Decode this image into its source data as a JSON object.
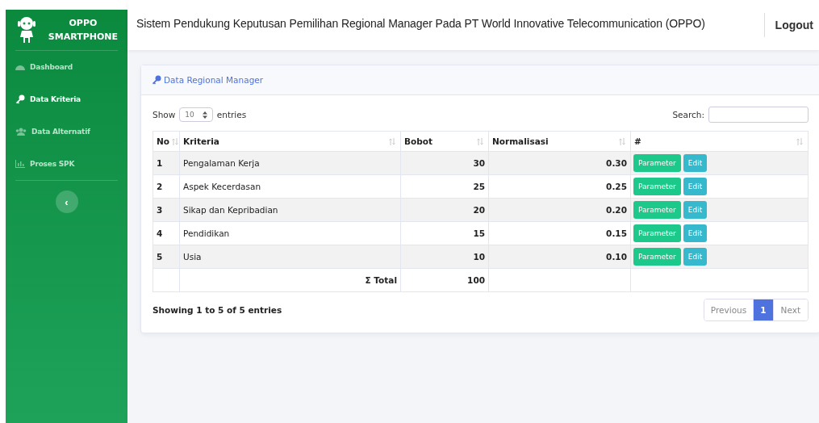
{
  "sidebar": {
    "brand": [
      "OPPO",
      "SMARTPHONE"
    ],
    "items": [
      {
        "label": "Dashboard",
        "selected": false
      },
      {
        "label": "Data Kriteria",
        "selected": true
      },
      {
        "label": "Data Alternatif",
        "selected": false
      },
      {
        "label": "Proses SPK",
        "selected": false
      }
    ],
    "toggle": "‹"
  },
  "topbar": {
    "title": "Sistem Pendukung Keputusan Pemilihan Regional Manager Pada PT World Innovative Telecommunication (OPPO)",
    "logout": "Logout"
  },
  "card": {
    "title": "Data Regional Manager",
    "show_label": "Show",
    "page_size": "10",
    "entries_label": "entries",
    "search_label": "Search:",
    "table": {
      "columns": [
        "No",
        "Kriteria",
        "Bobot",
        "Normalisasi",
        "#"
      ],
      "rows": [
        {
          "no": "1",
          "kriteria": "Pengalaman Kerja",
          "bobot": "30",
          "normalisasi": "0.30",
          "actions": [
            "Parameter",
            "Edit"
          ]
        },
        {
          "no": "2",
          "kriteria": "Aspek Kecerdasan",
          "bobot": "25",
          "normalisasi": "0.25",
          "actions": [
            "Parameter",
            "Edit"
          ]
        },
        {
          "no": "3",
          "kriteria": "Sikap dan Kepribadian",
          "bobot": "20",
          "normalisasi": "0.20",
          "actions": [
            "Parameter",
            "Edit"
          ]
        },
        {
          "no": "4",
          "kriteria": "Pendidikan",
          "bobot": "15",
          "normalisasi": "0.15",
          "actions": [
            "Parameter",
            "Edit"
          ]
        },
        {
          "no": "5",
          "kriteria": "Usia",
          "bobot": "10",
          "normalisasi": "0.10",
          "actions": [
            "Parameter",
            "Edit"
          ]
        }
      ],
      "total": {
        "label": "Σ Total",
        "value": "100"
      }
    },
    "info": "Showing 1 to 5 of 5 entries",
    "pagination": [
      {
        "label": "Previous",
        "kind": "prev",
        "selected": false
      },
      {
        "label": "1",
        "kind": "page",
        "selected": true
      },
      {
        "label": "Next",
        "kind": "next",
        "selected": false
      }
    ]
  }
}
